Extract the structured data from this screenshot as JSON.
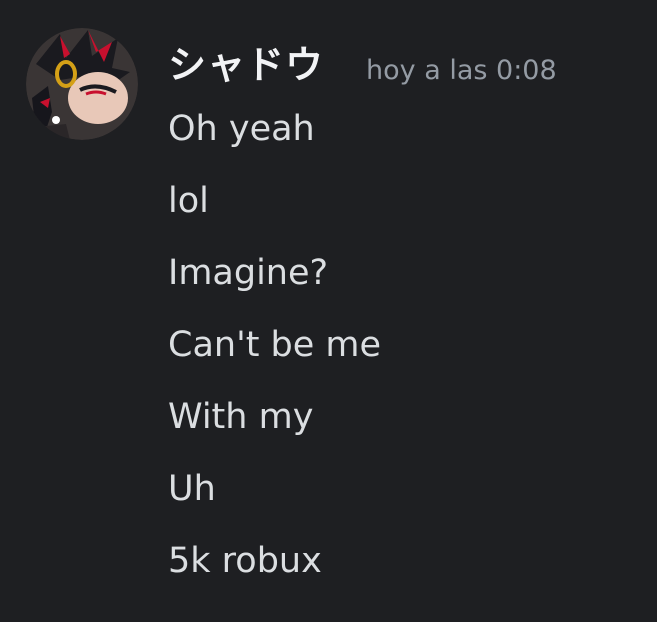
{
  "author": {
    "name": "シャドウ",
    "avatar_icon": "user-avatar",
    "timestamp": "hoy a las 0:08"
  },
  "messages": [
    {
      "text": "Oh yeah"
    },
    {
      "text": "lol"
    },
    {
      "text": "Imagine?"
    },
    {
      "text": "Can't be me"
    },
    {
      "text": "With my"
    },
    {
      "text": "Uh"
    },
    {
      "text": "5k robux"
    }
  ],
  "colors": {
    "background": "#1e1f22",
    "username": "#f2f3f5",
    "timestamp": "#949ba4",
    "message_text": "#dbdee1"
  }
}
